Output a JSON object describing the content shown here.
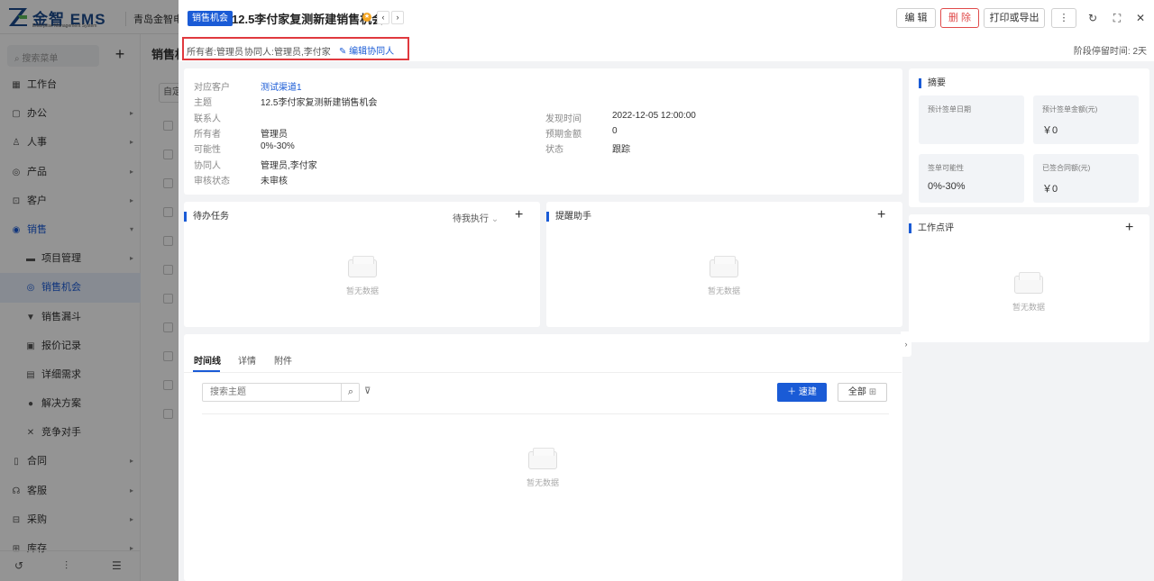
{
  "app": {
    "logo_name": "金智 EMS",
    "logo_sub": "Enterprise Management System",
    "company": "青岛金智电"
  },
  "sidebar": {
    "search_placeholder": "搜索菜单",
    "items": [
      {
        "label": "工作台",
        "icon": "dashboard-icon"
      },
      {
        "label": "办公",
        "icon": "office-icon"
      },
      {
        "label": "人事",
        "icon": "hr-icon"
      },
      {
        "label": "产品",
        "icon": "product-icon"
      },
      {
        "label": "客户",
        "icon": "customer-icon"
      },
      {
        "label": "销售",
        "icon": "sales-icon"
      },
      {
        "label": "项目管理",
        "icon": "folder-icon"
      },
      {
        "label": "销售机会",
        "icon": "opportunity-icon"
      },
      {
        "label": "销售漏斗",
        "icon": "funnel-icon"
      },
      {
        "label": "报价记录",
        "icon": "quote-icon"
      },
      {
        "label": "详细需求",
        "icon": "requirement-icon"
      },
      {
        "label": "解决方案",
        "icon": "bulb-icon"
      },
      {
        "label": "竞争对手",
        "icon": "competitor-icon"
      },
      {
        "label": "合同",
        "icon": "contract-icon"
      },
      {
        "label": "客服",
        "icon": "service-icon"
      },
      {
        "label": "采购",
        "icon": "purchase-icon"
      },
      {
        "label": "库存",
        "icon": "stock-icon"
      }
    ]
  },
  "background": {
    "page_title": "销售机",
    "button": "自定"
  },
  "drawer": {
    "type_tag": "销售机会",
    "title": "12.5李付家复测新建销售机会",
    "buttons": {
      "edit": "编 辑",
      "delete": "删 除",
      "print_export": "打印或导出",
      "more": "⋮"
    },
    "owner_label": "所有者:",
    "owner_value": "管理员",
    "collab_label": "协同人:",
    "collab_value": "管理员,李付家",
    "edit_collab": "编辑协同人",
    "stage_stay_label": "阶段停留时间:",
    "stage_stay_value": "2天"
  },
  "info": {
    "left": [
      {
        "k": "对应客户",
        "v": "测试渠道1",
        "link": true
      },
      {
        "k": "主题",
        "v": "12.5李付家复测新建销售机会"
      },
      {
        "k": "联系人",
        "v": ""
      },
      {
        "k": "所有者",
        "v": "管理员"
      },
      {
        "k": "可能性",
        "v": "0%-30%"
      },
      {
        "k": "协同人",
        "v": "管理员,李付家"
      },
      {
        "k": "审核状态",
        "v": "未审核"
      }
    ],
    "right": [
      {
        "k": "发现时间",
        "v": "2022-12-05 12:00:00"
      },
      {
        "k": "预期金额",
        "v": "0"
      },
      {
        "k": "状态",
        "v": "跟踪"
      }
    ]
  },
  "todo": {
    "title": "待办任务",
    "filter": "待我执行",
    "empty": "暂无数据"
  },
  "reminder": {
    "title": "提醒助手",
    "empty": "暂无数据"
  },
  "timeline": {
    "tabs": [
      "时间线",
      "详情",
      "附件"
    ],
    "search_placeholder": "搜索主题",
    "new_button": "速建",
    "all_button": "全部",
    "empty": "暂无数据"
  },
  "summary": {
    "title": "摘要",
    "tiles": [
      {
        "k": "预计签单日期",
        "v": ""
      },
      {
        "k": "预计签单金额(元)",
        "v": "￥0"
      },
      {
        "k": "签单可能性",
        "v": "0%-30%"
      },
      {
        "k": "已签合同额(元)",
        "v": "￥0"
      }
    ]
  },
  "review": {
    "title": "工作点评",
    "empty": "暂无数据"
  }
}
